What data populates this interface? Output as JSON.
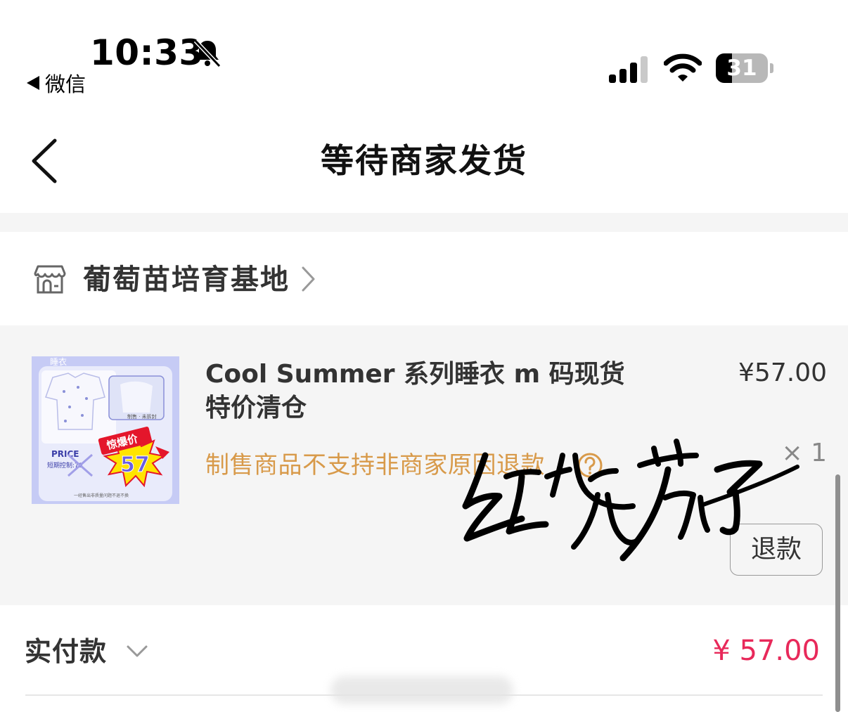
{
  "status_bar": {
    "time": "10:33",
    "back_app": "微信",
    "battery_level": "31",
    "icons": [
      "bell-muted-icon",
      "signal-icon",
      "wifi-icon",
      "battery-icon"
    ]
  },
  "nav": {
    "title": "等待商家发货",
    "back_icon": "chevron-left-icon"
  },
  "store": {
    "name": "葡萄苗培育基地",
    "icon": "store-icon"
  },
  "product": {
    "title": "Cool Summer 系列睡衣 m 码现货特价清仓",
    "price": "¥57.00",
    "note": "制售商品不支持非商家原因退款",
    "quantity": "× 1",
    "refund_label": "退款",
    "thumb": {
      "tag": "睡衣",
      "price_word": "PRICE",
      "badge_title": "惊爆价",
      "badge_value": "57"
    }
  },
  "payment": {
    "label": "实付款",
    "amount": "¥ 57.00"
  },
  "watermark": "红烧茄子",
  "colors": {
    "accent_red": "#e8295a",
    "note_orange": "#d89a4a",
    "card_bg": "#f5f5f5"
  }
}
